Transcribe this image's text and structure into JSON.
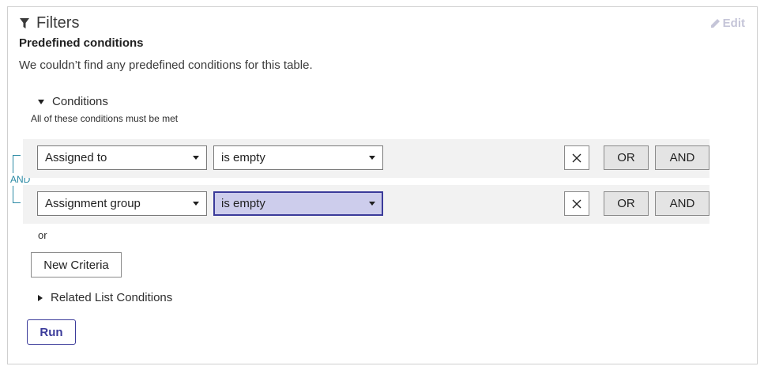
{
  "filters": {
    "title": "Filters",
    "edit_label": "Edit",
    "predefined_title": "Predefined conditions",
    "predefined_message": "We couldn’t find any predefined conditions for this table."
  },
  "conditions": {
    "section_label": "Conditions",
    "must_text": "All of these conditions must be met",
    "and_connector": "AND",
    "rows": [
      {
        "field": "Assigned to",
        "operator": "is empty",
        "or_label": "OR",
        "and_label": "AND"
      },
      {
        "field": "Assignment group",
        "operator": "is empty",
        "or_label": "OR",
        "and_label": "AND"
      }
    ],
    "or_separator": "or",
    "new_criteria_label": "New Criteria"
  },
  "related": {
    "label": "Related List Conditions"
  },
  "run_label": "Run",
  "colors": {
    "accent": "#3b3b9a",
    "and_connector": "#2b8aa4",
    "active_select_bg": "#cdcdec",
    "row_bg": "#f2f2f2"
  },
  "icons": {
    "filter": "filter-icon",
    "edit": "pencil-icon",
    "remove": "close-icon"
  }
}
